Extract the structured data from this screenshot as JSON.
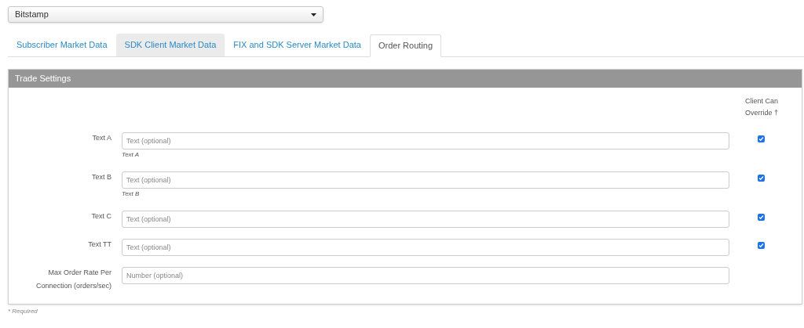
{
  "exchange_select": {
    "value": "Bitstamp"
  },
  "tabs": [
    {
      "label": "Subscriber Market Data",
      "selected": false,
      "highlighted": false
    },
    {
      "label": "SDK Client Market Data",
      "selected": false,
      "highlighted": true
    },
    {
      "label": "FIX and SDK Server Market Data",
      "selected": false,
      "highlighted": false
    },
    {
      "label": "Order Routing",
      "selected": true,
      "highlighted": false
    }
  ],
  "panel": {
    "title": "Trade Settings",
    "override_header": [
      "Client Can",
      "Override †"
    ],
    "fields": [
      {
        "label": "Text A",
        "placeholder": "Text (optional)",
        "hint": "Text A",
        "override": true
      },
      {
        "label": "Text B",
        "placeholder": "Text (optional)",
        "hint": "Text B",
        "override": true
      },
      {
        "label": "Text C",
        "placeholder": "Text (optional)",
        "override": true
      },
      {
        "label": "Text TT",
        "placeholder": "Text (optional)",
        "override": true
      },
      {
        "label": "Max Order Rate Per Connection (orders/sec)",
        "placeholder": "Number (optional)"
      }
    ]
  },
  "footnote": "* Required"
}
